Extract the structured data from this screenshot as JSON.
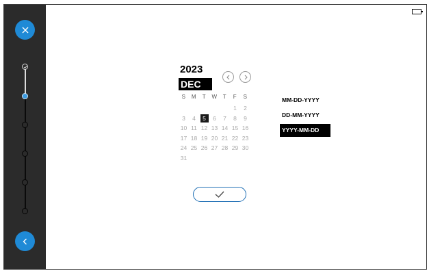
{
  "calendar": {
    "year": "2023",
    "month": "DEC",
    "weekdays": [
      "S",
      "M",
      "T",
      "W",
      "T",
      "F",
      "S"
    ],
    "days": [
      "",
      "",
      "",
      "",
      "",
      "1",
      "2",
      "3",
      "4",
      "5",
      "6",
      "7",
      "8",
      "9",
      "10",
      "11",
      "12",
      "13",
      "14",
      "15",
      "16",
      "17",
      "18",
      "19",
      "20",
      "21",
      "22",
      "23",
      "24",
      "25",
      "26",
      "27",
      "28",
      "29",
      "30",
      "31"
    ],
    "selected_day": "5"
  },
  "date_formats": [
    "MM-DD-YYYY",
    "DD-MM-YYYY",
    "YYYY-MM-DD"
  ],
  "selected_format": "YYYY-MM-DD",
  "stepper": {
    "total_steps": 6,
    "completed_steps": 1,
    "current_step": 2
  },
  "icons": {
    "close": "close-icon",
    "back": "chevron-left-icon",
    "prev": "chevron-left-icon",
    "next": "chevron-right-icon",
    "confirm": "check-icon",
    "battery": "battery-icon"
  },
  "colors": {
    "accent": "#1f8ad6",
    "sidebar": "#2b2b2b",
    "selected": "#000000"
  }
}
